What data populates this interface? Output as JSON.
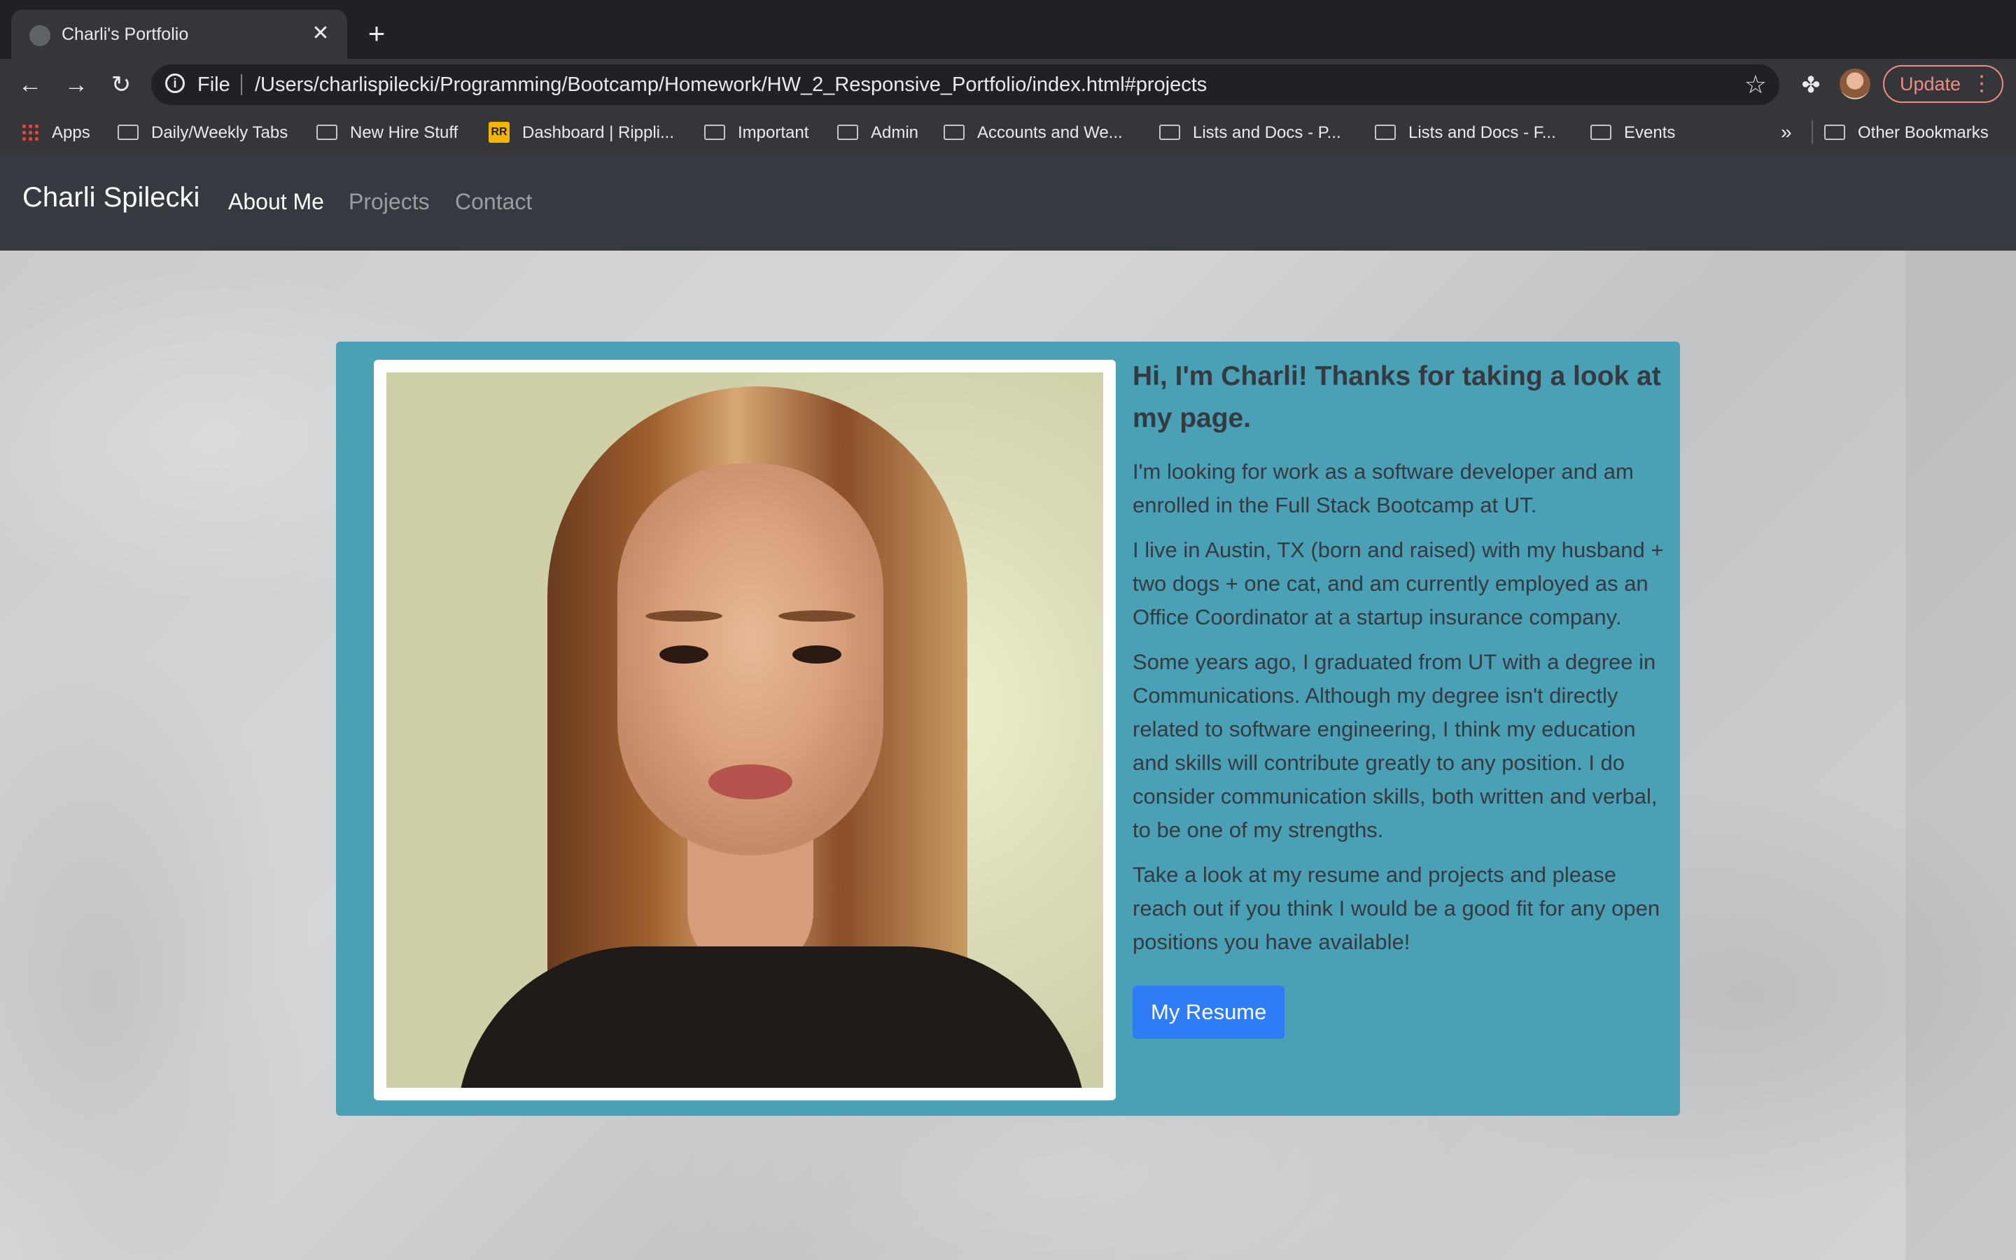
{
  "browser": {
    "tab_title": "Charli's Portfolio",
    "close_glyph": "✕",
    "new_tab_glyph": "+",
    "back_glyph": "←",
    "forward_glyph": "→",
    "reload_glyph": "↻",
    "scheme_label": "File",
    "url": "/Users/charlispilecki/Programming/Bootcamp/Homework/HW_2_Responsive_Portfolio/index.html#projects",
    "star_glyph": "☆",
    "extensions_glyph": "✤",
    "update_label": "Update",
    "menu_glyph": "⋮",
    "bookmarks": [
      "Apps",
      "Daily/Weekly Tabs",
      "New Hire Stuff",
      "Dashboard | Rippli...",
      "Important",
      "Admin",
      "Accounts and We...",
      "Lists and Docs - P...",
      "Lists and Docs - F...",
      "Events"
    ],
    "more_bookmarks_glyph": "»",
    "other_bookmarks": "Other Bookmarks"
  },
  "site": {
    "brand": "Charli Spilecki",
    "nav": [
      "About Me",
      "Projects",
      "Contact"
    ],
    "active_nav": "About Me"
  },
  "about": {
    "headline": "Hi, I'm Charli! Thanks for taking a look at my page.",
    "paragraphs": [
      "I'm looking for work as a software developer and am enrolled in the Full Stack Bootcamp at UT.",
      "I live in Austin, TX (born and raised) with my husband + two dogs + one cat, and am currently employed as an Office Coordinator at a startup insurance company.",
      "Some years ago, I graduated from UT with a degree in Communications. Although my degree isn't directly related to software engineering, I think my education and skills will contribute greatly to any position. I do consider communication skills, both written and verbal, to be one of my strengths.",
      "Take a look at my resume and projects and please reach out if you think I would be a good fit for any open positions you have available!"
    ],
    "button_label": "My Resume"
  },
  "colors": {
    "navbar": "#343a40",
    "card": "#4aa0b5",
    "button": "#2e7df7"
  }
}
